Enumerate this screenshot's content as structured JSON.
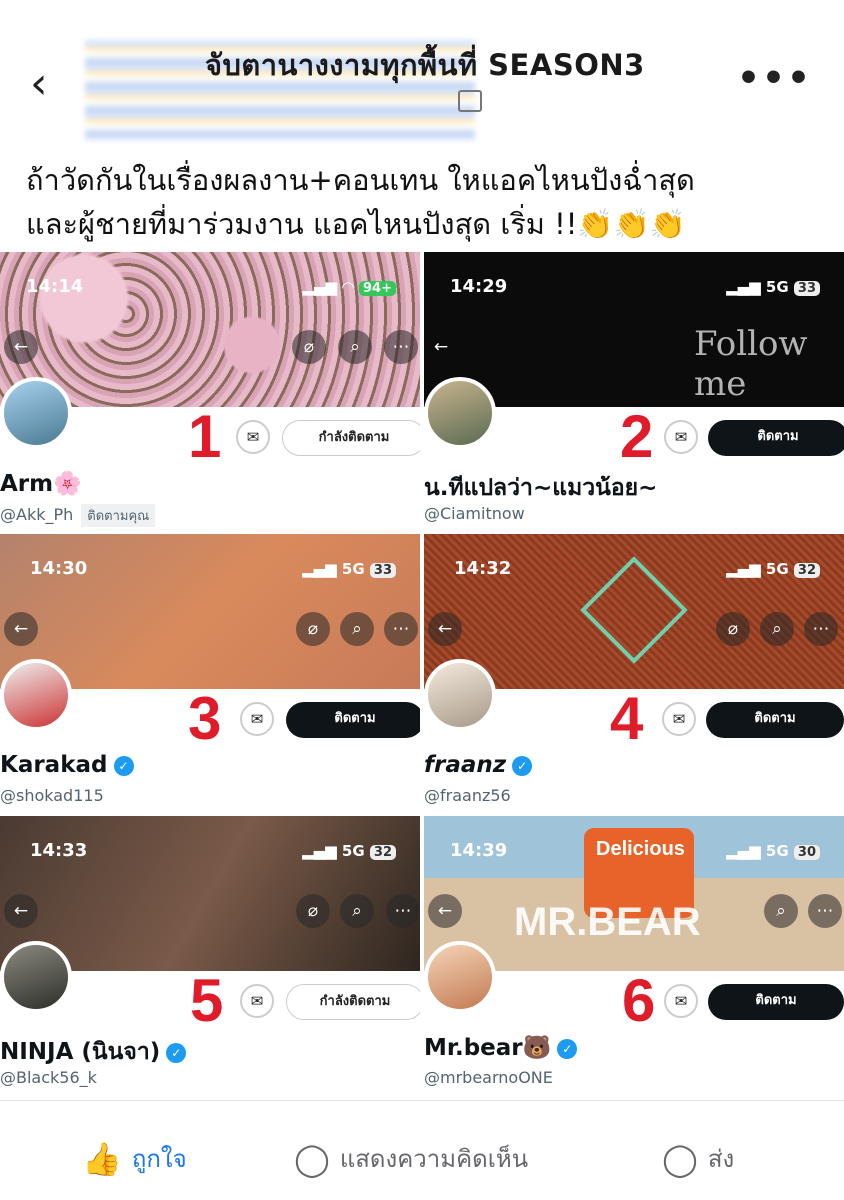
{
  "header": {
    "back_icon": "chevron-left-icon",
    "group_name": "จับตานางงามทุกพื้นที่ SEASON3",
    "more_icon": "more-horizontal-icon"
  },
  "caption": {
    "line1": "ถ้าวัดกันในเรื่องผลงาน+คอนเทน ใหแอคไหนปังฉ่ำสุด",
    "line2": "และผู้ชายที่มาร่วมงาน แอคไหนปังสุด เริ่ม !!👏👏👏"
  },
  "cards": [
    {
      "number": "1",
      "time": "14:14",
      "signal": "",
      "battery": "94+",
      "name": "Arm🌸",
      "handle": "@Akk_Ph",
      "follows_you": "ติดตามคุณ",
      "button": "กำลังติดตาม",
      "verified": false
    },
    {
      "number": "2",
      "time": "14:29",
      "signal": "5G",
      "battery": "33",
      "name": "น.ทีแปลว่า~แมวน้อย~",
      "handle": "@Ciamitnow",
      "follows_you": "",
      "button": "ติดตาม",
      "verified": false,
      "overlay": "Follow me"
    },
    {
      "number": "3",
      "time": "14:30",
      "signal": "5G",
      "battery": "33",
      "name": "Karakad",
      "handle": "@shokad115",
      "follows_you": "",
      "button": "ติดตาม",
      "verified": true
    },
    {
      "number": "4",
      "time": "14:32",
      "signal": "5G",
      "battery": "32",
      "name": "fraanz",
      "handle": "@fraanz56",
      "follows_you": "",
      "button": "ติดตาม",
      "verified": true
    },
    {
      "number": "5",
      "time": "14:33",
      "signal": "5G",
      "battery": "32",
      "name": "NINJA (นินจา)",
      "handle": "@Black56_k",
      "follows_you": "",
      "button": "กำลังติดตาม",
      "verified": true
    },
    {
      "number": "6",
      "time": "14:39",
      "signal": "5G",
      "battery": "30",
      "name": "Mr.bear🐻",
      "handle": "@mrbearnoONE",
      "follows_you": "",
      "button": "ติดตาม",
      "verified": true,
      "overlay": "MR.BEAR",
      "overlay2": "Delicious"
    }
  ],
  "actions": {
    "like": "ถูกใจ",
    "comment": "แสดงความคิดเห็น",
    "share": "ส่ง"
  },
  "colors": {
    "accent": "#1877f2",
    "number_red": "#e01b2a",
    "verified_blue": "#1d9bf0",
    "follow_dark": "#0f1419"
  }
}
